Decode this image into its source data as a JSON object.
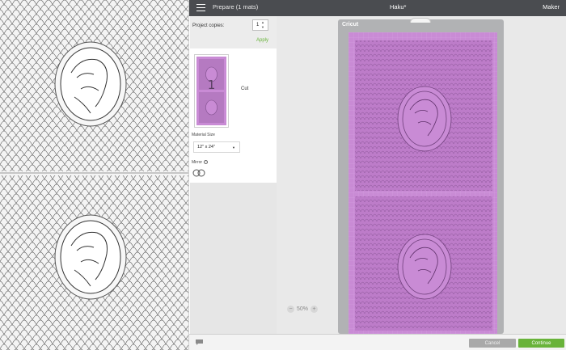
{
  "topbar": {
    "title": "Prepare (1 mats)",
    "project_name": "Haku*",
    "machine": "Maker",
    "menu_icon": "hamburger-menu-icon"
  },
  "panel": {
    "copies_label": "Project copies:",
    "copies_value": "1",
    "apply_label": "Apply",
    "mat_number": "1",
    "mat_label": "Cut",
    "material_size_label": "Material Size",
    "material_size_value": "12\" x 24\"",
    "mirror_label": "Mirror"
  },
  "mat": {
    "brand": "Cricut"
  },
  "zoom": {
    "value": "50%",
    "minus_icon": "zoom-out-icon",
    "plus_icon": "zoom-in-icon"
  },
  "bottombar": {
    "chat_icon": "chat-bubble-icon",
    "cancel_label": "Cancel",
    "continue_label": "Continue"
  },
  "colors": {
    "topbar": "#4a4c50",
    "mat_purple": "#c98bd5",
    "apply_green": "#68b33a",
    "continue_green": "#69b33a"
  }
}
